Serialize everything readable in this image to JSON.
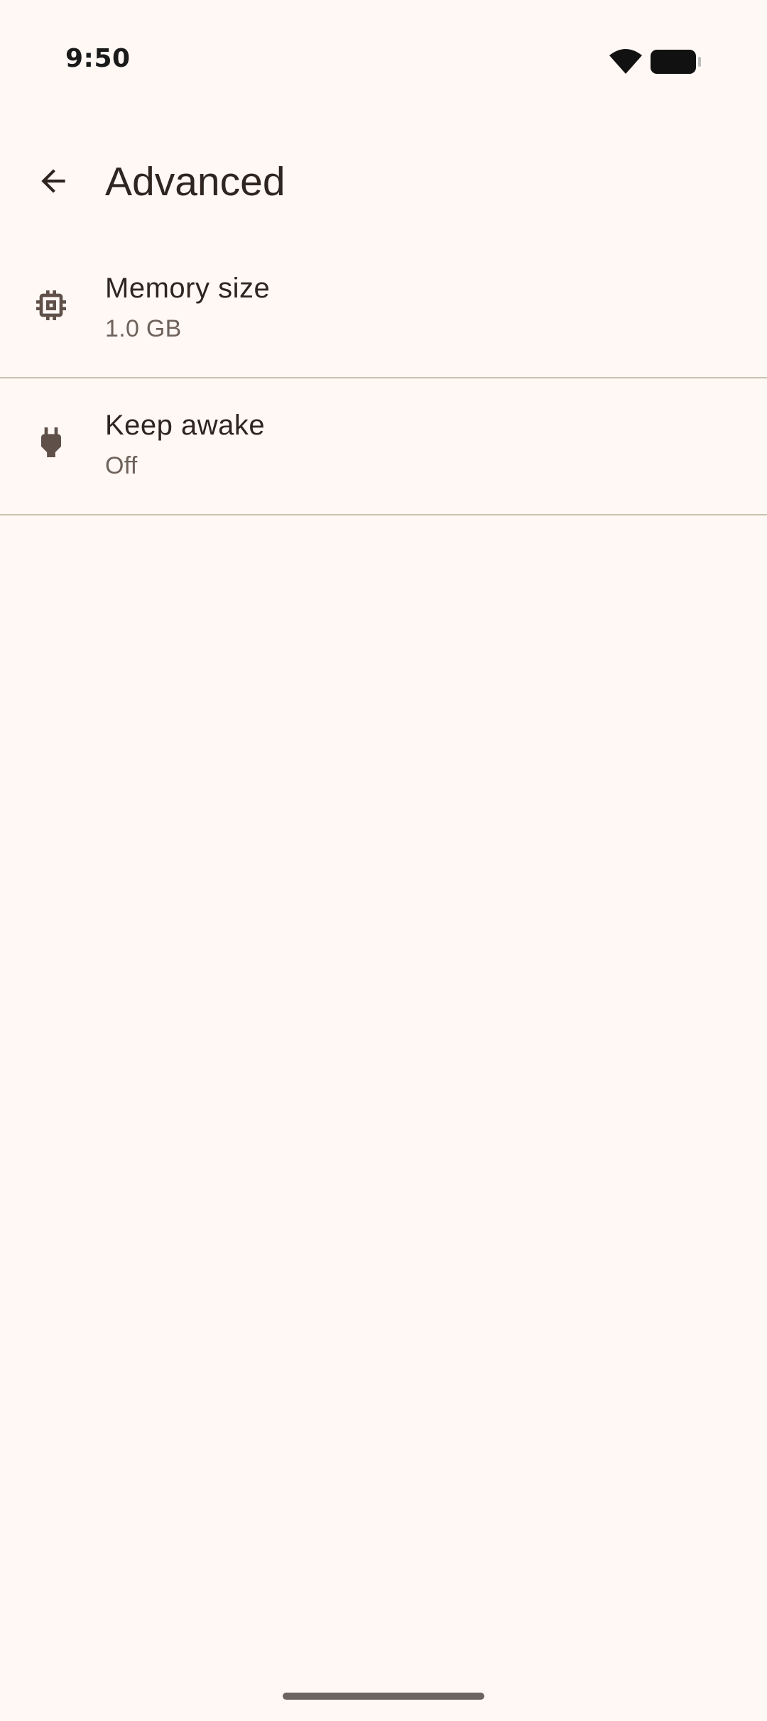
{
  "status_bar": {
    "time": "9:50",
    "wifi_icon": "wifi-icon",
    "battery_icon": "battery-icon"
  },
  "header": {
    "back_icon": "arrow-back-icon",
    "title": "Advanced"
  },
  "settings": [
    {
      "icon": "memory-chip-icon",
      "title": "Memory size",
      "value": "1.0 GB"
    },
    {
      "icon": "power-plug-icon",
      "title": "Keep awake",
      "value": "Off"
    }
  ],
  "colors": {
    "background": "#FFF8F5",
    "on_surface": "#2F2520",
    "on_surface_variant": "#6E625B",
    "icon": "#5F5149",
    "divider": "#C9C2B1"
  }
}
